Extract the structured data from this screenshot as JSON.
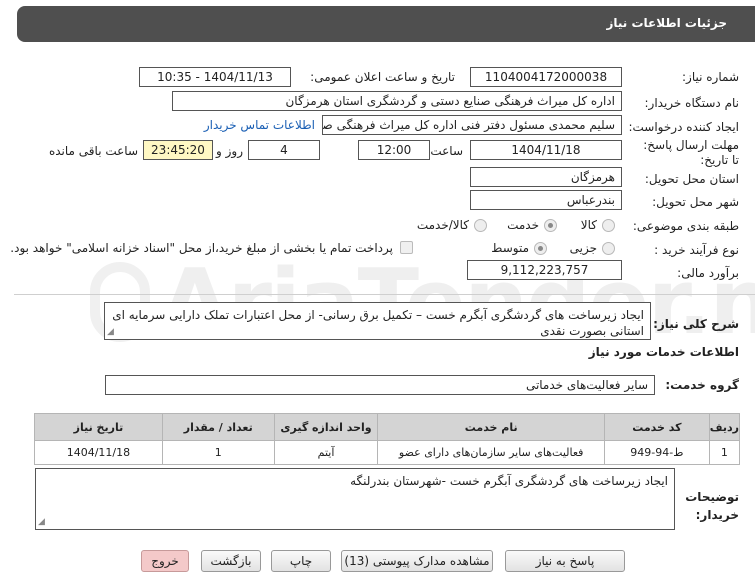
{
  "header": {
    "title": "جزئیات اطلاعات نیاز"
  },
  "labels": {
    "need_number": "شماره نیاز:",
    "announce_datetime": "تاریخ و ساعت اعلان عمومی:",
    "buyer_org": "نام دستگاه خریدار:",
    "requester": "ایجاد کننده درخواست:",
    "deadline": "مهلت ارسال پاسخ: تا تاریخ:",
    "time_word": "ساعت",
    "days_and": "روز و",
    "remaining": "ساعت باقی مانده",
    "delivery_province": "استان محل تحویل:",
    "delivery_city": "شهر محل تحویل:",
    "category": "طبقه بندی موضوعی:",
    "process_type": "نوع فرآیند خرید :",
    "financial_estimate": "برآورد مالی:",
    "general_desc": "شرح کلی نیاز:",
    "services_info": "اطلاعات خدمات مورد نیاز",
    "service_group": "گروه خدمت:",
    "buyer_notes": "توضیحات خریدار:"
  },
  "fields": {
    "need_number": "1104004172000038",
    "announce_datetime": "1404/11/13 - 10:35",
    "buyer_org": "اداره کل میراث فرهنگی  صنایع دستی و گردشگری استان هرمزگان",
    "requester": "سلیم محمدی مسئول دفتر فنی اداره کل میراث فرهنگی  صنایع دستی و گردشگری",
    "contact_link": "اطلاعات تماس خریدار",
    "deadline_date": "1404/11/18",
    "deadline_time": "12:00",
    "days": "4",
    "remaining_time": "23:45:20",
    "province": "هرمزگان",
    "city": "بندرعباس",
    "estimate": "9,112,223,757",
    "general_desc": "ایجاد زیرساخت های گردشگری آبگرم خست – تکمیل برق رسانی- از محل اعتبارات تملک دارایی سرمایه ای استانی بصورت نقدی",
    "service_group": "سایر فعالیت‌های خدماتی",
    "buyer_notes": "ایجاد زیرساخت های گردشگری آبگرم خست -شهرستان بندرلنگه"
  },
  "category_options": {
    "goods": "کالا",
    "service": "خدمت",
    "goods_service": "کالا/خدمت",
    "selected": "service"
  },
  "process_options": {
    "minor": "جزیی",
    "medium": "متوسط",
    "selected": "medium"
  },
  "payment_note": "پرداخت تمام یا بخشی از مبلغ خرید،از محل \"اسناد خزانه اسلامی\" خواهد بود.",
  "table": {
    "headers": [
      "ردیف",
      "کد خدمت",
      "نام خدمت",
      "واحد اندازه گیری",
      "تعداد / مقدار",
      "تاریخ نیاز"
    ],
    "rows": [
      [
        "1",
        "ط-94-949",
        "فعالیت‌های سایر سازمان‌های دارای عضو",
        "آیتم",
        "1",
        "1404/11/18"
      ]
    ]
  },
  "buttons": {
    "reply": "پاسخ به نیاز",
    "attachments": "مشاهده مدارک پیوستی (13)",
    "print": "چاپ",
    "back": "بازگشت",
    "exit": "خروج"
  },
  "watermark": "AriaTender.neT"
}
